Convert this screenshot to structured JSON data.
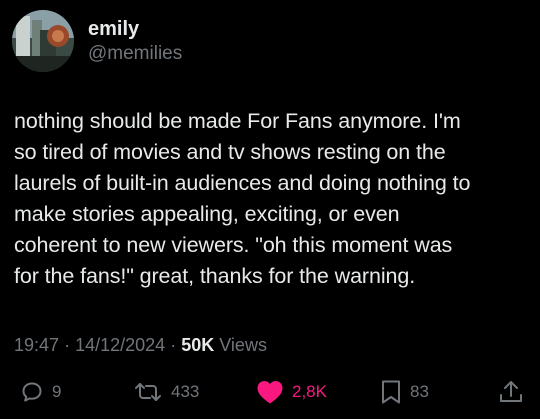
{
  "author": {
    "display_name": "emily",
    "handle": "@memilies"
  },
  "tweet": {
    "text": "nothing should be made For Fans anymore. I'm\nso tired of movies and tv shows resting on the\nlaurels of built-in audiences and doing nothing to\nmake stories appealing, exciting, or even\ncoherent to new viewers. \"oh this moment was\nfor the fans!\" great, thanks for the warning.",
    "time": "19:47",
    "date": "14/12/2024",
    "separator": "·",
    "views_count": "50K",
    "views_label": "Views"
  },
  "actions": {
    "replies": "9",
    "reposts": "433",
    "likes": "2,8K",
    "bookmarks": "83"
  },
  "icons": {
    "reply": "reply-icon",
    "repost": "repost-icon",
    "like": "heart-icon",
    "bookmark": "bookmark-icon",
    "share": "share-icon"
  },
  "colors": {
    "background": "#000000",
    "text": "#e7e9ea",
    "secondary": "#71767b",
    "like": "#f91880"
  }
}
